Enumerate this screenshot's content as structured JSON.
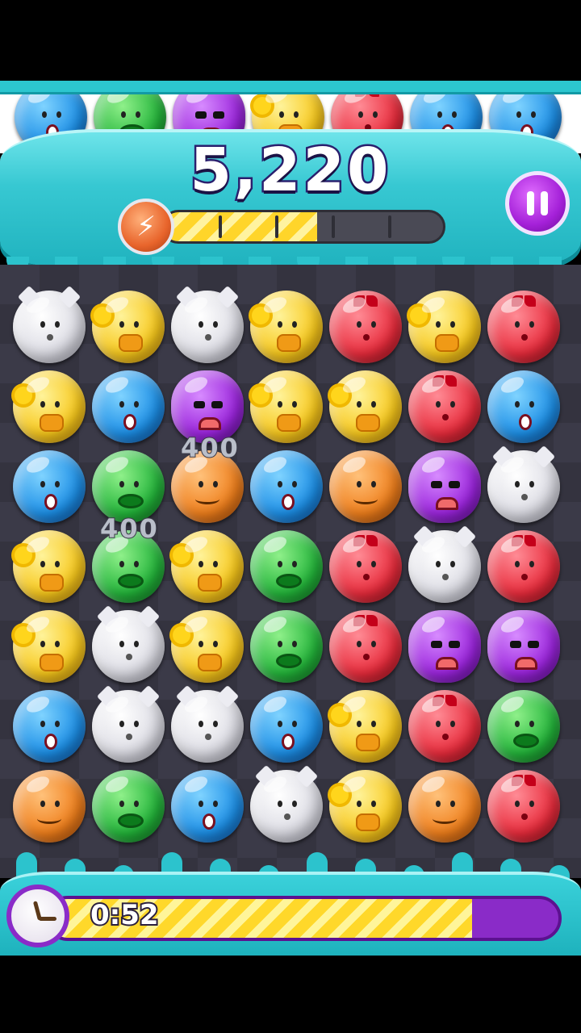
{
  "game": {
    "score": "5,220",
    "power_level": 0.55,
    "timer": "0:52",
    "timer_remaining": 0.83
  },
  "preview_row": [
    "blue",
    "green",
    "purple",
    "yellow",
    "red",
    "blue",
    "blue"
  ],
  "board": [
    [
      "white",
      "yellow",
      "white",
      "yellow",
      "red",
      "yellow",
      "red"
    ],
    [
      "yellow",
      "blue",
      "purple",
      "yellow",
      "yellow",
      "red",
      "blue"
    ],
    [
      "blue",
      "green",
      "orange",
      "blue",
      "orange",
      "purple",
      "white"
    ],
    [
      "yellow",
      "green",
      "yellow",
      "green",
      "red",
      "white",
      "red"
    ],
    [
      "yellow",
      "white",
      "yellow",
      "green",
      "red",
      "purple",
      "purple"
    ],
    [
      "blue",
      "white",
      "white",
      "blue",
      "yellow",
      "red",
      "green"
    ],
    [
      "orange",
      "green",
      "blue",
      "white",
      "yellow",
      "orange",
      "red"
    ]
  ],
  "floating_scores": [
    {
      "text": "400"
    },
    {
      "text": "400"
    }
  ],
  "icons": {
    "power": "lightning-icon",
    "pause": "pause-icon",
    "timer": "clock-icon"
  }
}
